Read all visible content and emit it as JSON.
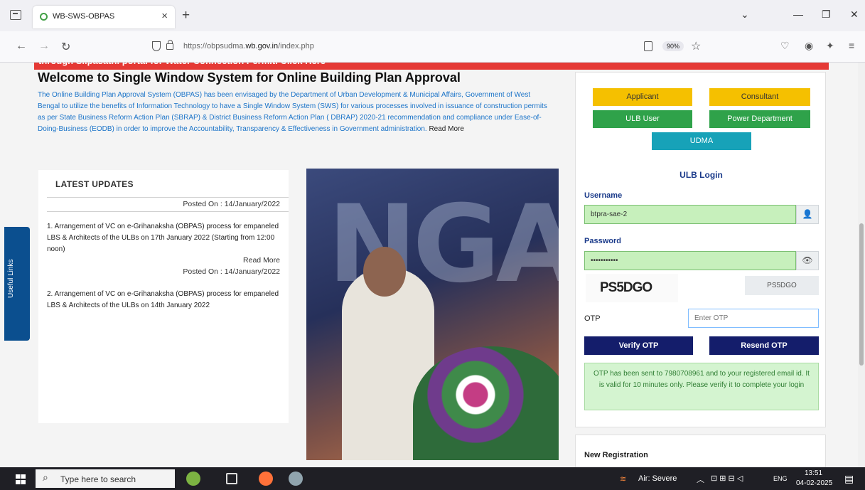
{
  "browser": {
    "tab_title": "WB-SWS-OBPAS",
    "tab_close": "×",
    "new_tab": "+",
    "url_prefix": "https://obpsudma.",
    "url_domain": "wb.gov.in",
    "url_path": "/index.php",
    "zoom": "90%"
  },
  "page": {
    "marquee_text": "through Silpasathi portal for Water Connection Permit. Click Here",
    "welcome_title": "Welcome to Single Window System for Online Building Plan Approval",
    "intro_text": "The Online Building Plan Approval System (OBPAS) has been envisaged by the Department of Urban Development & Municipal Affairs, Government of West Bengal to utilize the benefits of Information Technology to have a Single Window System (SWS) for various processes involved in issuance of construction permits as per State Business Reform Action Plan (SBRAP) & District Business Reform Action Plan ( DBRAP) 2020-21 recommendation and compliance under Ease-of-Doing-Business (EODB) in order to improve the Accountability, Transparency & Effectiveness in Government administration.",
    "intro_read_more": "Read More",
    "useful_links": "Useful Links"
  },
  "updates": {
    "heading": "LATEST UPDATES",
    "items": [
      {
        "posted": "Posted On : 14/January/2022",
        "text": "1. Arrangement of VC on e-Grihanaksha (OBPAS) process for empaneled LBS & Architects of the ULBs on 17th January 2022 (Starting from 12:00 noon)",
        "read_more": "Read More"
      },
      {
        "posted": "Posted On : 14/January/2022",
        "text": "2. Arrangement of VC on e-Grihanaksha (OBPAS) process for empaneled LBS & Architects of the ULBs on 14th January 2022"
      }
    ]
  },
  "login": {
    "roles": {
      "applicant": "Applicant",
      "consultant": "Consultant",
      "ulb_user": "ULB User",
      "power_department": "Power Department",
      "udma": "UDMA"
    },
    "heading": "ULB Login",
    "username_label": "Username",
    "username_value": "btpra-sae-2",
    "password_label": "Password",
    "password_value": "•••••••••••",
    "captcha_image_text": "PS5DGO",
    "captcha_value": "PS5DGO",
    "otp_label": "OTP",
    "otp_placeholder": "Enter OTP",
    "verify_button": "Verify OTP",
    "resend_button": "Resend OTP",
    "otp_message": "OTP has been sent to 7980708961 and to your registered email id. It is valid for 10 minutes only. Please verify it to complete your login",
    "new_registration": "New Registration"
  },
  "taskbar": {
    "search_placeholder": "Type here to search",
    "weather": "Air: Severe",
    "language": "ENG",
    "time": "13:51",
    "date": "04-02-2025"
  },
  "colors": {
    "applicant": "#f5c000",
    "ulb_user": "#2fa24a",
    "udma": "#17a2b8",
    "navy": "#141d6b",
    "marquee": "#e53935"
  }
}
